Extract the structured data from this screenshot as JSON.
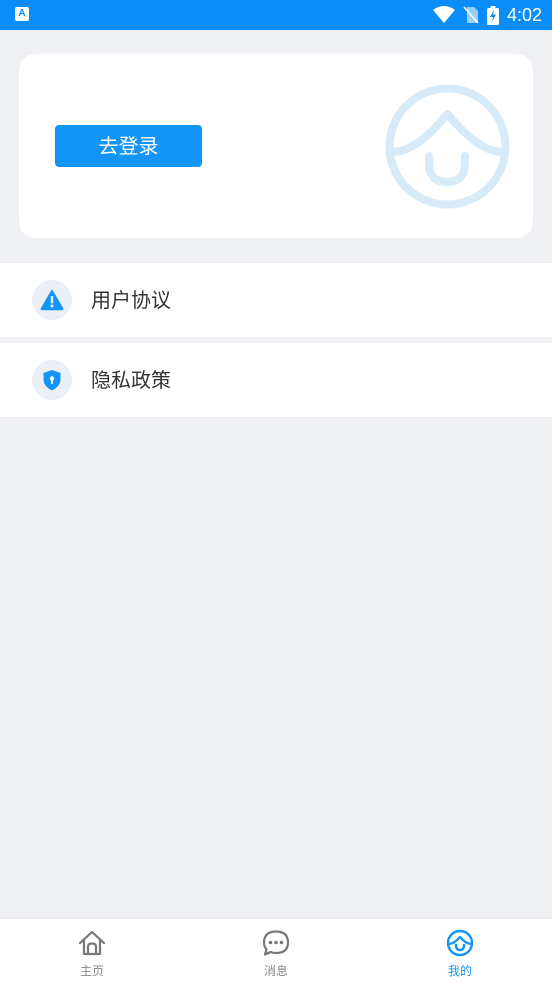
{
  "status_bar": {
    "left_icon_label": "A",
    "time": "4:02"
  },
  "profile_card": {
    "login_button_label": "去登录"
  },
  "menu": {
    "items": [
      {
        "label": "用户协议",
        "icon": "alert-triangle-icon"
      },
      {
        "label": "隐私政策",
        "icon": "shield-icon"
      }
    ]
  },
  "tabbar": {
    "tabs": [
      {
        "label": "主页",
        "icon": "home-icon",
        "active": false
      },
      {
        "label": "消息",
        "icon": "chat-bubble-icon",
        "active": false
      },
      {
        "label": "我的",
        "icon": "face-icon",
        "active": true
      }
    ]
  },
  "colors": {
    "accent": "#0A8DF6",
    "background": "#EEF0F4",
    "inactive_tab": "#888888"
  }
}
